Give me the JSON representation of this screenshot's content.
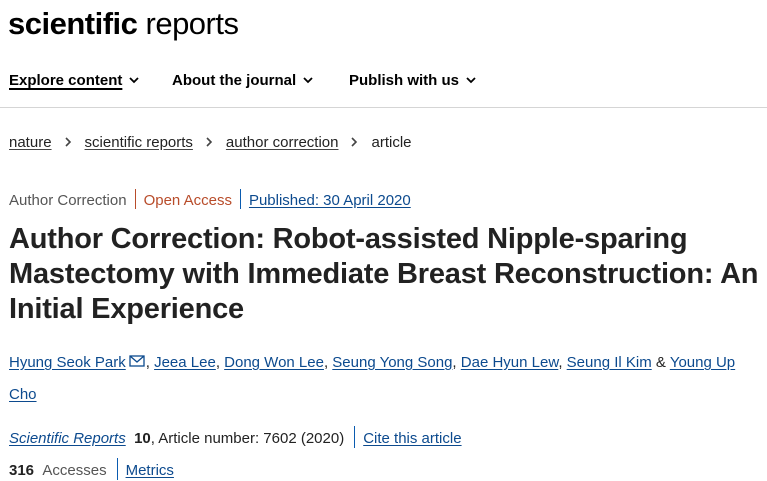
{
  "site": {
    "logo_bold": "scientific",
    "logo_thin": " reports"
  },
  "nav": [
    {
      "label": "Explore content",
      "active": true,
      "icon": "chevron-down-icon"
    },
    {
      "label": "About the journal",
      "icon": "chevron-down-icon"
    },
    {
      "label": "Publish with us",
      "icon": "chevron-down-icon"
    }
  ],
  "breadcrumb": [
    "nature",
    "scientific reports",
    "author correction",
    "article"
  ],
  "article_meta": {
    "type": "Author Correction",
    "access": "Open Access",
    "published": "Published: 30 April 2020"
  },
  "title": "Author Correction: Robot-assisted Nipple-sparing Mastectomy with Immediate Breast Reconstruction: An Initial Experience",
  "authors": [
    "Hyung Seok Park",
    "Jeea Lee",
    "Dong Won Lee",
    "Seung Yong Song",
    "Dae Hyun Lew",
    "Seung Il Kim",
    "Young Up Cho"
  ],
  "author_separators": {
    "comma": ",",
    "ampersand": "&"
  },
  "citation": {
    "journal": "Scientific Reports",
    "volume": "10",
    "rest": ", Article number: 7602 (2020)",
    "cite_link": "Cite this article"
  },
  "metrics": {
    "count": "316",
    "label": "Accesses",
    "link": "Metrics"
  },
  "colors": {
    "link": "#0c4a8e",
    "open_access": "#b84c2a",
    "text": "#222222"
  }
}
